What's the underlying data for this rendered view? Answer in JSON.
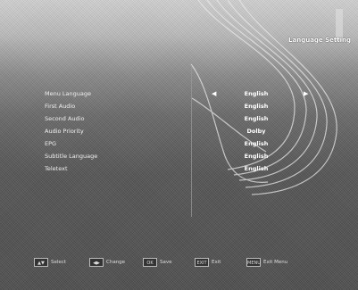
{
  "header": {
    "title": "Language Setting"
  },
  "menu": {
    "labels": [
      "Menu Language",
      "First Audio",
      "Second Audio",
      "Audio Priority",
      "EPG",
      "Subtitle Language",
      "Teletext"
    ],
    "values": [
      "English",
      "English",
      "English",
      "Dolby",
      "English",
      "English",
      "English"
    ],
    "arrow_left": "◀",
    "arrow_right": "▶"
  },
  "footer": {
    "hints": [
      {
        "key": "▲▼",
        "label": "Select"
      },
      {
        "key": "◀▶",
        "label": "Change"
      },
      {
        "key": "OK",
        "label": "Save"
      },
      {
        "key": "EXIT",
        "label": "Exit"
      },
      {
        "key": "MENU",
        "label": "Exit Menu"
      }
    ]
  },
  "colors": {
    "text": "#ffffff",
    "background": "#555555",
    "header_bg": "#d4d4d4"
  }
}
